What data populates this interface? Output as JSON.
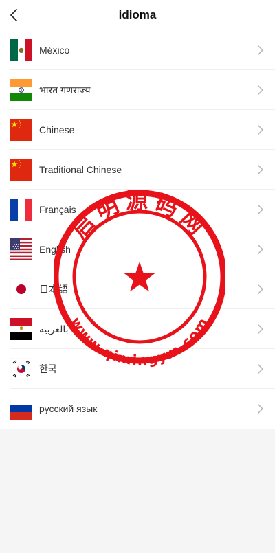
{
  "header": {
    "title": "idioma",
    "back_icon": "chevron-left-icon"
  },
  "languages": [
    {
      "label": "México",
      "flag": "mexico-flag-icon"
    },
    {
      "label": "भारत गणराज्य",
      "flag": "india-flag-icon"
    },
    {
      "label": "Chinese",
      "flag": "china-flag-icon"
    },
    {
      "label": "Traditional Chinese",
      "flag": "china-flag-icon"
    },
    {
      "label": "Français",
      "flag": "france-flag-icon"
    },
    {
      "label": "English",
      "flag": "usa-flag-icon"
    },
    {
      "label": "日本語",
      "flag": "japan-flag-icon"
    },
    {
      "label": "بالعربية",
      "flag": "egypt-flag-icon"
    },
    {
      "label": "한국",
      "flag": "korea-flag-icon"
    },
    {
      "label": "русский язык",
      "flag": "russia-flag-icon"
    }
  ],
  "row_icon": "chevron-right-icon",
  "watermark": {
    "top_text": "启明源码网",
    "bottom_text": "www.qimingym.com",
    "color": "#e8121a"
  }
}
